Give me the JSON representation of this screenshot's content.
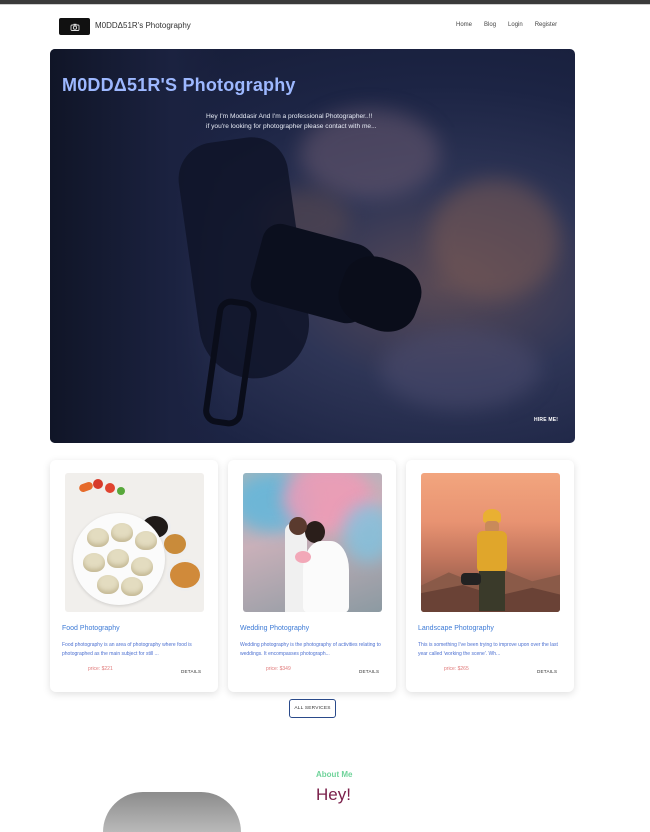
{
  "nav": {
    "brand": "M0DDΔ51R's Photography",
    "links": [
      "Home",
      "Blog",
      "Login",
      "Register"
    ]
  },
  "hero": {
    "title": "M0DDΔ51R'S Photography",
    "line1": "Hey I'm Moddasir And I'm a professional Photographer..!!",
    "line2": "if you're looking for photographer please contact with me...",
    "cta": "HIRE ME!"
  },
  "services": [
    {
      "title": "Food Photography",
      "desc": "Food photography is an area of photography where food is photographed as the main subject for still ...",
      "price": "price: $221",
      "details": "DETAILS"
    },
    {
      "title": "Wedding Photography",
      "desc": "Wedding photography is the photography of activities relating to weddings. It encompasses photograph...",
      "price": "price: $349",
      "details": "DETAILS"
    },
    {
      "title": "Landscape Photography",
      "desc": "This is something I've been trying to improve upon over the last year called 'working the scene'. Wh...",
      "price": "price: $265",
      "details": "DETAILS"
    }
  ],
  "all_services": "ALL SERVICES",
  "about": {
    "label": "About Me",
    "heading": "Hey!"
  },
  "colors": {
    "hero_title": "#9db8ff",
    "card_title": "#3e7bd6",
    "price": "#e07a7a",
    "about_label": "#6fd39a",
    "about_heading": "#7a1f4a"
  }
}
